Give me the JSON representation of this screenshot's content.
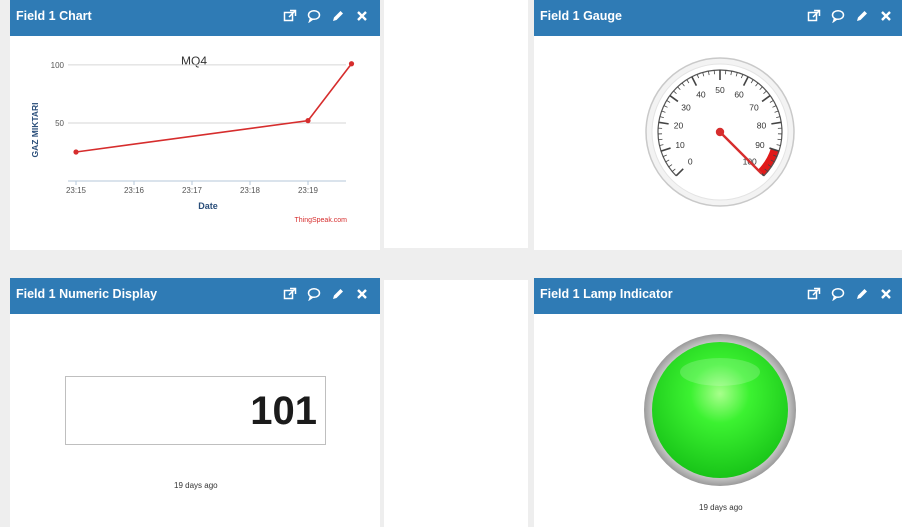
{
  "cards": {
    "chart": {
      "title": "Field 1 Chart",
      "chart_data": {
        "type": "line",
        "title": "MQ4",
        "xlabel": "Date",
        "ylabel": "GAZ MIKTARI",
        "x_ticks": [
          "23:15",
          "23:16",
          "23:17",
          "23:18",
          "23:19"
        ],
        "y_ticks": [
          50,
          100
        ],
        "x": [
          "23:15",
          "23:19",
          "23:19:45"
        ],
        "series": [
          {
            "values": [
              25,
              52,
              101
            ],
            "color": "#d62d2d"
          }
        ],
        "credit": "ThingSpeak.com"
      }
    },
    "gauge": {
      "title": "Field 1 Gauge",
      "min": 0,
      "max": 100,
      "ticks": [
        0,
        10,
        20,
        30,
        40,
        50,
        60,
        70,
        80,
        90,
        100
      ],
      "value": 101,
      "red_band": [
        90,
        100
      ],
      "needle_color": "#d62d2d"
    },
    "numeric": {
      "title": "Field 1 Numeric Display",
      "value": "101",
      "updated": "19 days ago"
    },
    "lamp": {
      "title": "Field 1 Lamp Indicator",
      "color": "#22e622",
      "updated": "19 days ago"
    }
  },
  "colors": {
    "header": "#2f7bb5",
    "accent_red": "#d62d2d"
  },
  "header_icons": [
    "external-link-icon",
    "comment-icon",
    "pencil-icon",
    "close-icon"
  ]
}
